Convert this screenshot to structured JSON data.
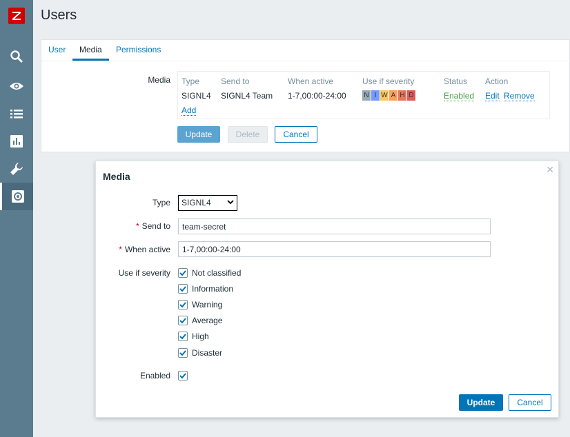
{
  "header": {
    "title": "Users"
  },
  "sidebar": {
    "logo_letter": "Z",
    "items": [
      {
        "icon": "search-icon"
      },
      {
        "icon": "eye-icon"
      },
      {
        "icon": "list-icon"
      },
      {
        "icon": "chart-icon"
      },
      {
        "icon": "wrench-icon"
      },
      {
        "icon": "gear-icon",
        "active": true
      }
    ]
  },
  "tabs": [
    {
      "label": "User"
    },
    {
      "label": "Media",
      "active": true
    },
    {
      "label": "Permissions"
    }
  ],
  "media": {
    "label": "Media",
    "headers": {
      "type": "Type",
      "send_to": "Send to",
      "when_active": "When active",
      "severity": "Use if severity",
      "status": "Status",
      "action": "Action"
    },
    "rows": [
      {
        "type": "SIGNL4",
        "send_to": "SIGNL4 Team",
        "when_active": "1-7,00:00-24:00",
        "severity": [
          "N",
          "I",
          "W",
          "A",
          "H",
          "D"
        ],
        "status": "Enabled",
        "edit": "Edit",
        "remove": "Remove"
      }
    ],
    "add_label": "Add",
    "severity_colors": [
      "#97aab3",
      "#7499ff",
      "#ffc859",
      "#ffa059",
      "#e97659",
      "#e45959"
    ]
  },
  "buttons": {
    "update": "Update",
    "delete": "Delete",
    "cancel": "Cancel"
  },
  "dialog": {
    "title": "Media",
    "type_label": "Type",
    "type_value": "SIGNL4",
    "send_to_label": "Send to",
    "send_to_value": "team-secret",
    "when_active_label": "When active",
    "when_active_value": "1-7,00:00-24:00",
    "severity_label": "Use if severity",
    "severities": [
      "Not classified",
      "Information",
      "Warning",
      "Average",
      "High",
      "Disaster"
    ],
    "enabled_label": "Enabled",
    "update": "Update",
    "cancel": "Cancel",
    "required_mark": "*"
  }
}
